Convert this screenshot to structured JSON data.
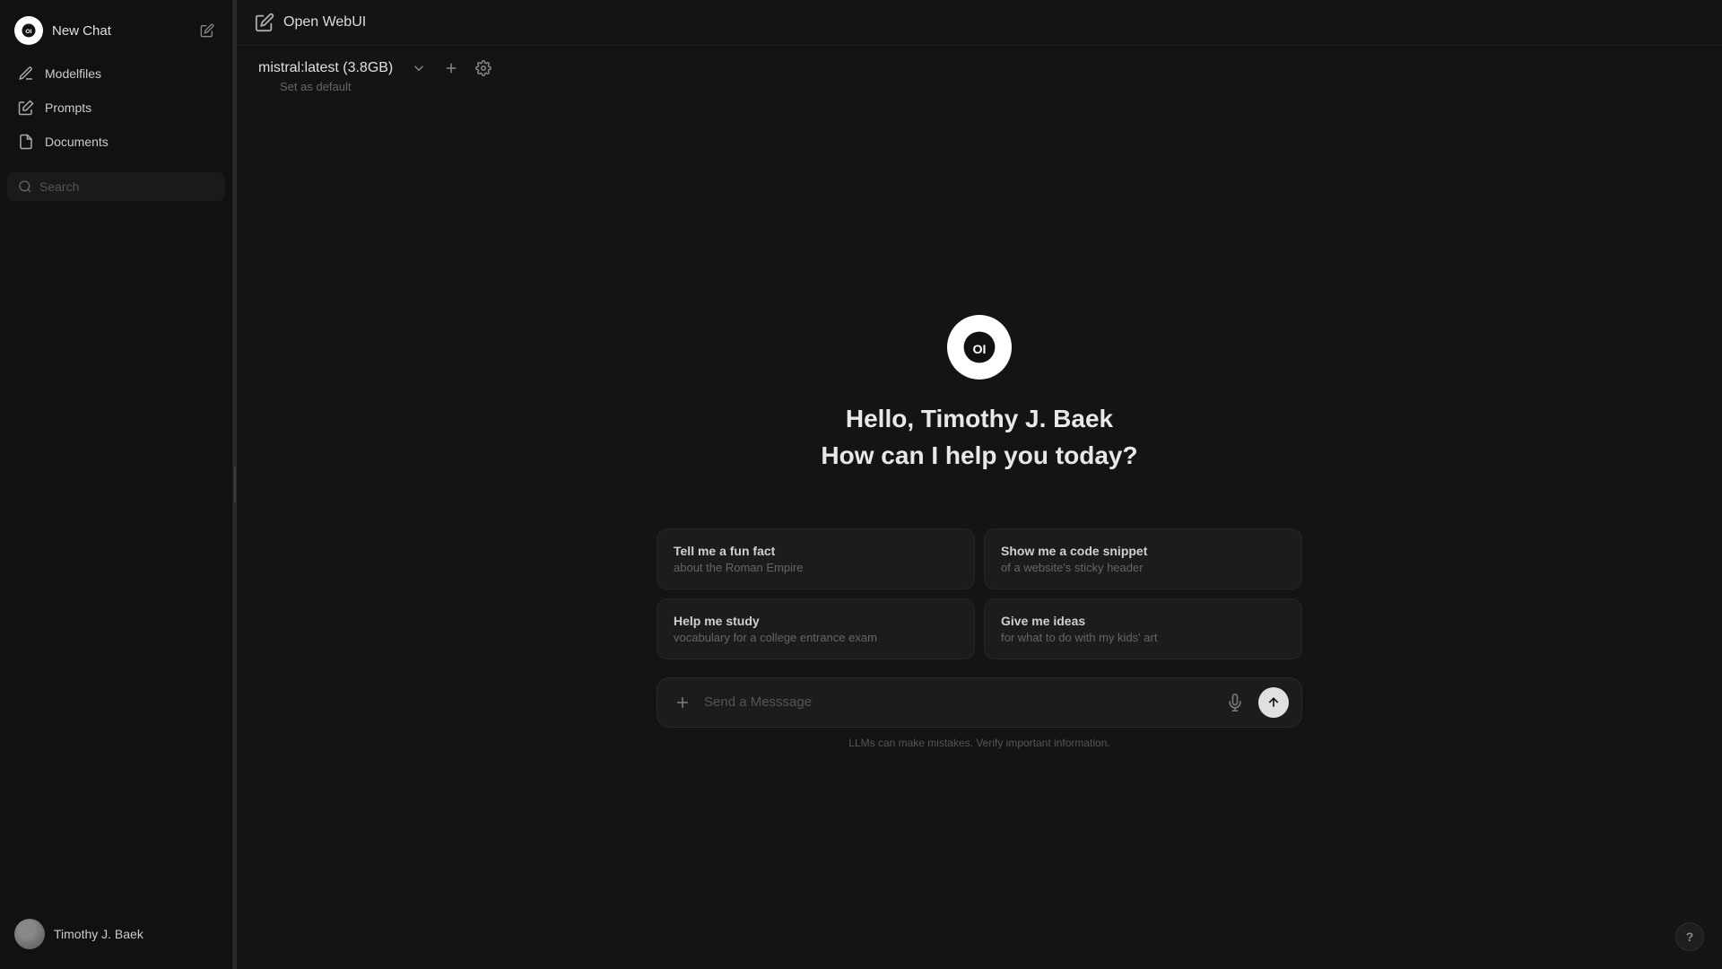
{
  "sidebar": {
    "logo_label": "OI",
    "new_chat_label": "New Chat",
    "nav_items": [
      {
        "id": "modelfiles",
        "label": "Modelfiles",
        "icon": "pencil"
      },
      {
        "id": "prompts",
        "label": "Prompts",
        "icon": "pen"
      },
      {
        "id": "documents",
        "label": "Documents",
        "icon": "file"
      }
    ],
    "search_placeholder": "Search",
    "user_name": "Timothy J. Baek"
  },
  "topbar": {
    "title": "Open WebUI",
    "icon": "pen-square"
  },
  "model_bar": {
    "model_name": "mistral:latest (3.8GB)",
    "set_default_label": "Set as default"
  },
  "welcome": {
    "greeting": "Hello, Timothy J. Baek",
    "subtext": "How can I help you today?"
  },
  "suggestions": [
    {
      "title": "Tell me a fun fact",
      "subtitle": "about the Roman Empire"
    },
    {
      "title": "Show me a code snippet",
      "subtitle": "of a website's sticky header"
    },
    {
      "title": "Help me study",
      "subtitle": "vocabulary for a college entrance exam"
    },
    {
      "title": "Give me ideas",
      "subtitle": "for what to do with my kids' art"
    }
  ],
  "input": {
    "placeholder": "Send a Messsage",
    "plus_label": "+",
    "mic_label": "mic",
    "send_label": "send"
  },
  "footer": {
    "disclaimer": "LLMs can make mistakes. Verify important information."
  },
  "help_label": "?"
}
